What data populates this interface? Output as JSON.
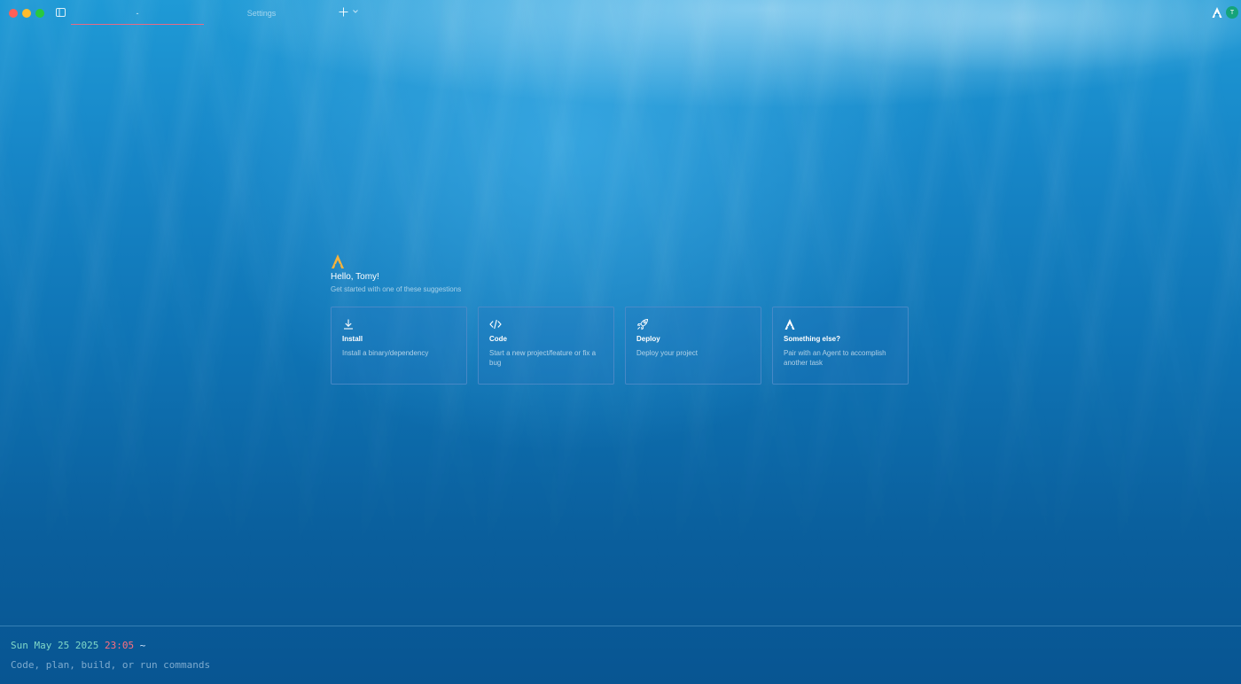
{
  "titlebar": {
    "tabs": [
      {
        "label": "-"
      },
      {
        "label": "Settings"
      }
    ]
  },
  "user": {
    "avatar_initial": "T"
  },
  "welcome": {
    "greeting": "Hello, Tomy!",
    "subtitle": "Get started with one of these suggestions"
  },
  "cards": [
    {
      "icon": "download-icon",
      "title": "Install",
      "description": "Install a binary/dependency"
    },
    {
      "icon": "code-icon",
      "title": "Code",
      "description": "Start a new project/feature or fix a bug"
    },
    {
      "icon": "rocket-icon",
      "title": "Deploy",
      "description": "Deploy your project"
    },
    {
      "icon": "warp-logo-icon",
      "title": "Something else?",
      "description": "Pair with an Agent to accomplish another task"
    }
  ],
  "prompt": {
    "date": "Sun May 25 2025",
    "time": "23:05",
    "directory": "~",
    "placeholder": "Code, plan, build, or run commands"
  },
  "colors": {
    "accent_logo": "#f5b23c",
    "avatar": "#15a37a",
    "tab_underline": "#e86a84",
    "prompt_date": "#7fd8c8",
    "prompt_time": "#ff6f7f"
  }
}
